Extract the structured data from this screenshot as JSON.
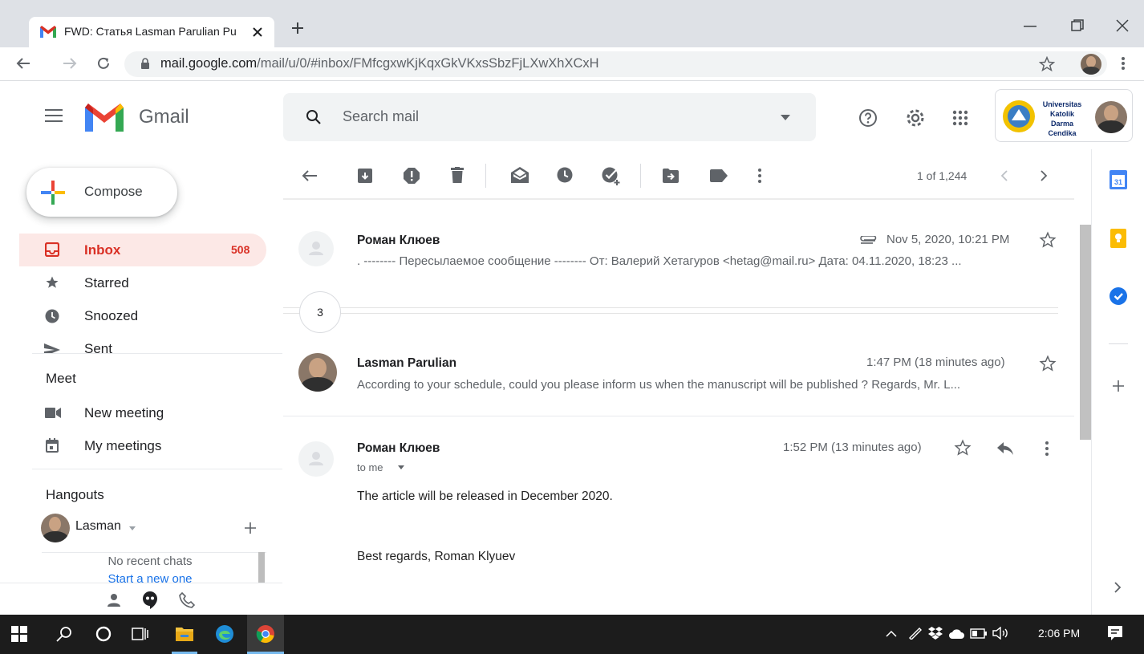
{
  "browser": {
    "tab_title": "FWD: Статья Lasman Parulian Pu",
    "url_host": "mail.google.com",
    "url_path": "/mail/u/0/#inbox/FMfcgxwKjKqxGkVKxsSbzFjLXwXhXCxH"
  },
  "gmail": {
    "logo_text": "Gmail",
    "search_placeholder": "Search mail",
    "account_org": [
      "Universitas",
      "Katolik",
      "Darma Cendika"
    ]
  },
  "sidebar": {
    "compose_label": "Compose",
    "items": [
      {
        "label": "Inbox",
        "count": "508",
        "icon": "inbox-icon"
      },
      {
        "label": "Starred",
        "icon": "star-icon"
      },
      {
        "label": "Snoozed",
        "icon": "clock-icon"
      },
      {
        "label": "Sent",
        "icon": "send-icon"
      }
    ],
    "meet": {
      "title": "Meet",
      "items": [
        {
          "label": "New meeting",
          "icon": "video-icon"
        },
        {
          "label": "My meetings",
          "icon": "calendar-icon"
        }
      ]
    },
    "hangouts": {
      "title": "Hangouts",
      "user": "Lasman",
      "no_chats": "No recent chats",
      "start_link": "Start a new one"
    }
  },
  "toolbar": {
    "pagination": "1 of 1,244"
  },
  "thread": {
    "collapsed_count": "3",
    "messages": [
      {
        "sender": "Роман Клюев",
        "date": "Nov 5, 2020, 10:21 PM",
        "snippet": ". -------- Пересылаемое сообщение -------- От: Валерий Хетагуров <hetag@mail.ru> Дата: 04.11.2020, 18:23 ..."
      },
      {
        "sender": "Lasman Parulian",
        "date": "1:47 PM (18 minutes ago)",
        "snippet": "According to your schedule, could you please inform us when the manuscript will be published ? Regards, Mr. L..."
      },
      {
        "sender": "Роман Клюев",
        "date": "1:52 PM (13 minutes ago)",
        "to": "to me",
        "body_line1": "The article will be released in December 2020.",
        "body_line2": "Best regards, Roman Klyuev"
      }
    ]
  },
  "taskbar": {
    "time": "2:06 PM"
  },
  "colors": {
    "gmail_red": "#d93025",
    "inbox_highlight": "#fce8e6",
    "taskbar": "#1c1c1c"
  }
}
